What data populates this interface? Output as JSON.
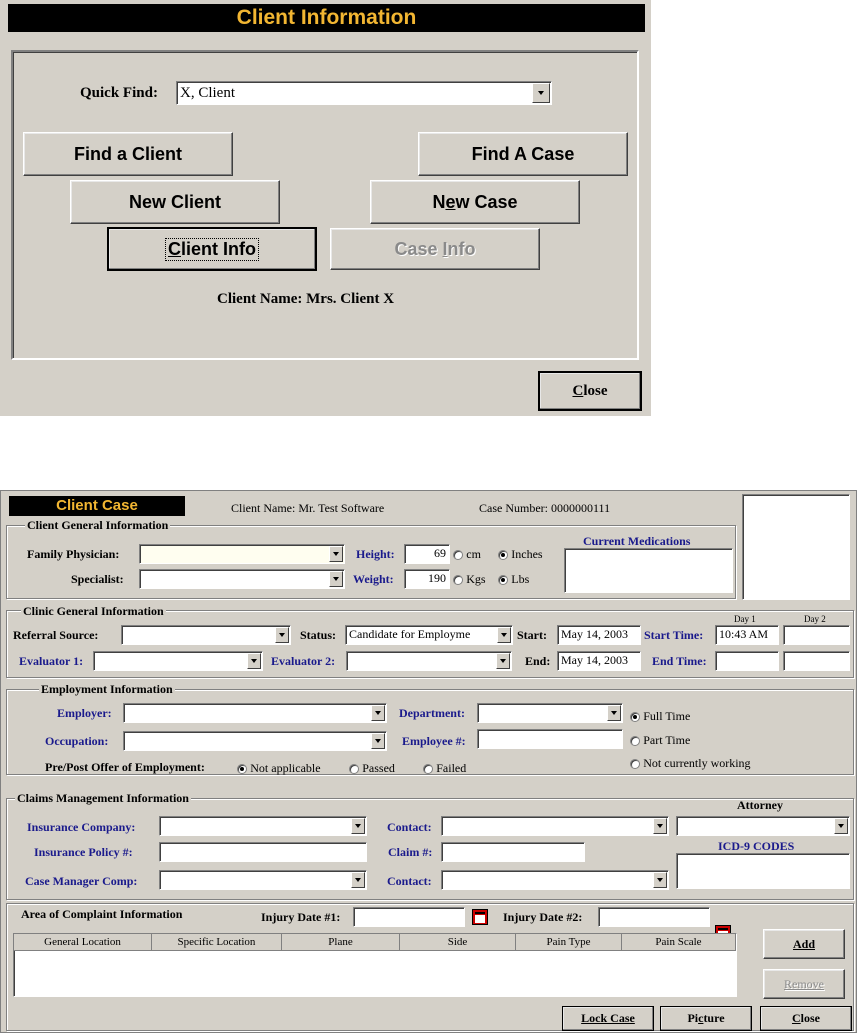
{
  "dialog1": {
    "title": "Client Information",
    "quick_find_label": "Quick Find:",
    "quick_find_value": "X, Client",
    "buttons": {
      "find_client": "Find a Client",
      "find_case": "Find A Case",
      "new_client": "New Client",
      "new_case_pre": "N",
      "new_case_u": "e",
      "new_case_post": "w Case",
      "client_info_u": "C",
      "client_info_post": "lient Info",
      "case_info_pre": "Case ",
      "case_info_u": "I",
      "case_info_post": "nfo",
      "close_u": "C",
      "close_post": "lose"
    },
    "client_name": "Client Name: Mrs. Client X"
  },
  "dialog2": {
    "title": "Client Case",
    "client_name": "Client Name: Mr. Test Software",
    "case_number": "Case Number: 0000000111",
    "general": {
      "title": "Client General Information",
      "family_physician_label": "Family Physician:",
      "family_physician_value": "",
      "specialist_label": "Specialist:",
      "specialist_value": "",
      "height_label": "Height:",
      "height_value": "69",
      "height_unit_cm": "cm",
      "height_unit_in": "Inches",
      "weight_label": "Weight:",
      "weight_value": "190",
      "weight_unit_kg": "Kgs",
      "weight_unit_lb": "Lbs",
      "medications_label": "Current Medications"
    },
    "clinic": {
      "title": "Clinic General Information",
      "day1": "Day 1",
      "day2": "Day 2",
      "referral_label": "Referral Source:",
      "status_label": "Status:",
      "status_value": "Candidate for Employme",
      "start_label": "Start:",
      "start_value": "May 14, 2003",
      "start_time_label": "Start Time:",
      "start_time_value": "10:43 AM",
      "evaluator1_label": "Evaluator 1:",
      "evaluator2_label": "Evaluator 2:",
      "end_label": "End:",
      "end_value": "May 14, 2003",
      "end_time_label": "End Time:"
    },
    "employment": {
      "title": "Employment Information",
      "employer_label": "Employer:",
      "department_label": "Department:",
      "occupation_label": "Occupation:",
      "employee_label": "Employee #:",
      "full_time": "Full Time",
      "part_time": "Part Time",
      "not_working": "Not currently working",
      "offer_label": "Pre/Post Offer of Employment:",
      "not_applicable": "Not applicable",
      "passed": "Passed",
      "failed": "Failed"
    },
    "claims": {
      "title": "Claims Management Information",
      "insurance_company_label": "Insurance Company:",
      "contact_label": "Contact:",
      "attorney_label": "Attorney",
      "policy_label": "Insurance Policy #:",
      "claim_label": "Claim #:",
      "icd_label": "ICD-9 CODES",
      "case_manager_label": "Case Manager Comp:",
      "contact2_label": "Contact:"
    },
    "complaint": {
      "title": "Area of Complaint  Information",
      "injury1_label": "Injury Date #1:",
      "injury2_label": "Injury Date #2:",
      "columns": [
        "General Location",
        "Specific Location",
        "Plane",
        "Side",
        "Pain Type",
        "Pain Scale"
      ]
    },
    "buttons": {
      "add": "Add",
      "remove": "Remove",
      "lock_case": "Lock Case",
      "picture_pre": "Pi",
      "picture_u": "c",
      "picture_post": "ture",
      "close_u": "C",
      "close_post": "lose"
    }
  }
}
